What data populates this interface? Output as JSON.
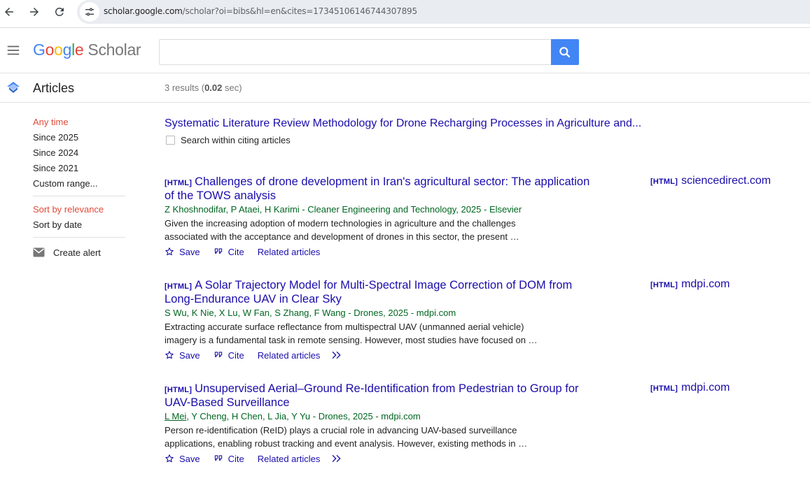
{
  "browser": {
    "url_host": "scholar.google.com",
    "url_path": "/scholar?oi=bibs&hl=en&cites=17345106146744307895",
    "back_icon": "arrow-left-icon",
    "forward_icon": "arrow-right-icon",
    "reload_icon": "reload-icon",
    "site_info_icon": "tune-icon"
  },
  "header": {
    "logo_letters": [
      "G",
      "o",
      "o",
      "g",
      "l",
      "e"
    ],
    "logo_colors": [
      "#4285f4",
      "#ea4335",
      "#fbbc05",
      "#4285f4",
      "#34a853",
      "#ea4335"
    ],
    "logo_product": "Scholar",
    "search_value": "",
    "search_placeholder": "",
    "accent": "#4285f4"
  },
  "articles_bar": {
    "title": "Articles",
    "results_prefix": "3 results (",
    "results_time": "0.02",
    "results_suffix": " sec)"
  },
  "sidebar": {
    "time_filters": [
      {
        "label": "Any time",
        "active": true
      },
      {
        "label": "Since 2025",
        "active": false
      },
      {
        "label": "Since 2024",
        "active": false
      },
      {
        "label": "Since 2021",
        "active": false
      },
      {
        "label": "Custom range...",
        "active": false
      }
    ],
    "sort_options": [
      {
        "label": "Sort by relevance",
        "active": true
      },
      {
        "label": "Sort by date",
        "active": false
      }
    ],
    "alert_label": "Create alert",
    "active_color": "#dd4b39"
  },
  "citing": {
    "title": "Systematic Literature Review Methodology for Drone Recharging Processes in Agriculture and...",
    "search_within_label": "Search within citing articles",
    "search_within_checked": false
  },
  "results": [
    {
      "tag": "[HTML]",
      "title": "Challenges of drone development in Iran's agricultural sector: The application of the TOWS analysis",
      "authors_linked": "",
      "authors": "Z Khoshnodifar, P Ataei, H Karimi - Cleaner Engineering and Technology, 2025 - Elsevier",
      "snippet": "Given the increasing adoption of modern technologies in agriculture and the challenges associated with the acceptance and development of drones in this sector, the present …",
      "save_label": "Save",
      "cite_label": "Cite",
      "related_label": "Related articles",
      "show_more": false,
      "side_tag": "[HTML]",
      "side_source": "sciencedirect.com"
    },
    {
      "tag": "[HTML]",
      "title": "A Solar Trajectory Model for Multi-Spectral Image Correction of DOM from Long-Endurance UAV in Clear Sky",
      "authors_linked": "",
      "authors": "S Wu, K Nie, X Lu, W Fan, S Zhang, F Wang - Drones, 2025 - mdpi.com",
      "snippet": "Extracting accurate surface reflectance from multispectral UAV (unmanned aerial vehicle) imagery is a fundamental task in remote sensing. However, most studies have focused on …",
      "save_label": "Save",
      "cite_label": "Cite",
      "related_label": "Related articles",
      "show_more": true,
      "side_tag": "[HTML]",
      "side_source": "mdpi.com"
    },
    {
      "tag": "[HTML]",
      "title": "Unsupervised Aerial–Ground Re-Identification from Pedestrian to Group for UAV-Based Surveillance",
      "authors_linked": "L Mei",
      "authors": ", Y Cheng, H Chen, L Jia, Y Yu - Drones, 2025 - mdpi.com",
      "snippet": "Person re-identification (ReID) plays a crucial role in advancing UAV-based surveillance applications, enabling robust tracking and event analysis. However, existing methods in …",
      "save_label": "Save",
      "cite_label": "Cite",
      "related_label": "Related articles",
      "show_more": true,
      "side_tag": "[HTML]",
      "side_source": "mdpi.com"
    }
  ]
}
